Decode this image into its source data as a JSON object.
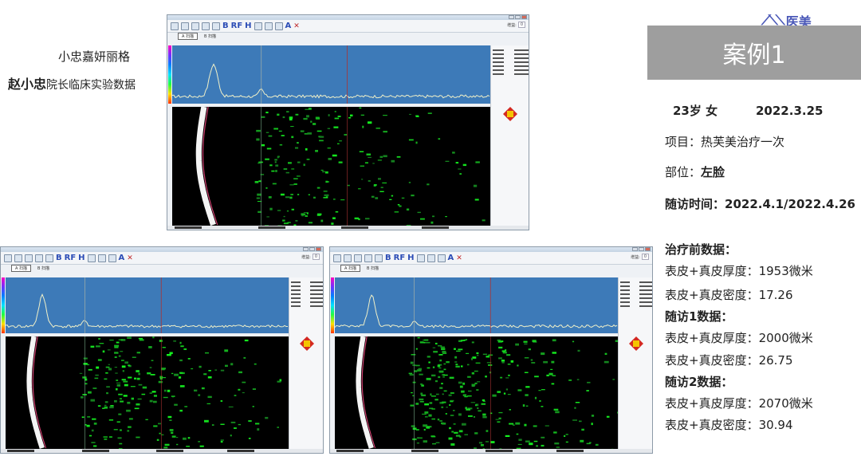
{
  "brand": {
    "line1": "小忠嘉妍丽格",
    "line2_name": "赵小忠",
    "line2_rest": "院长临床实验数据",
    "logo_text": "医美"
  },
  "case": {
    "title": "案例1",
    "age_sex": "23岁  女",
    "date": "2022.3.25",
    "project_label": "项目：",
    "project_value": "热芙美治疗一次",
    "site_label": "部位：",
    "site_value": "左脸",
    "followup_label": "随访时间：",
    "followup_value": "2022.4.1/2022.4.26",
    "sections": [
      {
        "heading": "治疗前数据：",
        "thickness": "表皮+真皮厚度：1953微米",
        "density": "表皮+真皮密度：17.26"
      },
      {
        "heading": "随访1数据：",
        "thickness": "表皮+真皮厚度：2000微米",
        "density": "表皮+真皮密度：26.75"
      },
      {
        "heading": "随访2数据：",
        "thickness": "表皮+真皮厚度：2070微米",
        "density": "表皮+真皮密度：30.94"
      }
    ]
  },
  "scan_ui": {
    "toolbar_b": "B",
    "toolbar_rf": "RF",
    "toolbar_h": "H",
    "toolbar_a": "A",
    "toolbar_close": "✕",
    "gain_label": "增益:",
    "gain_value": "0",
    "tab_a": "A 扫描",
    "tab_b": "B 扫描"
  },
  "colors": {
    "case_box_bg": "#9e9e9e",
    "ascan_bg": "#3d7ab8",
    "bscan_bg": "#000000",
    "tissue": "#1fb52d",
    "logo": "#4a58b8"
  }
}
